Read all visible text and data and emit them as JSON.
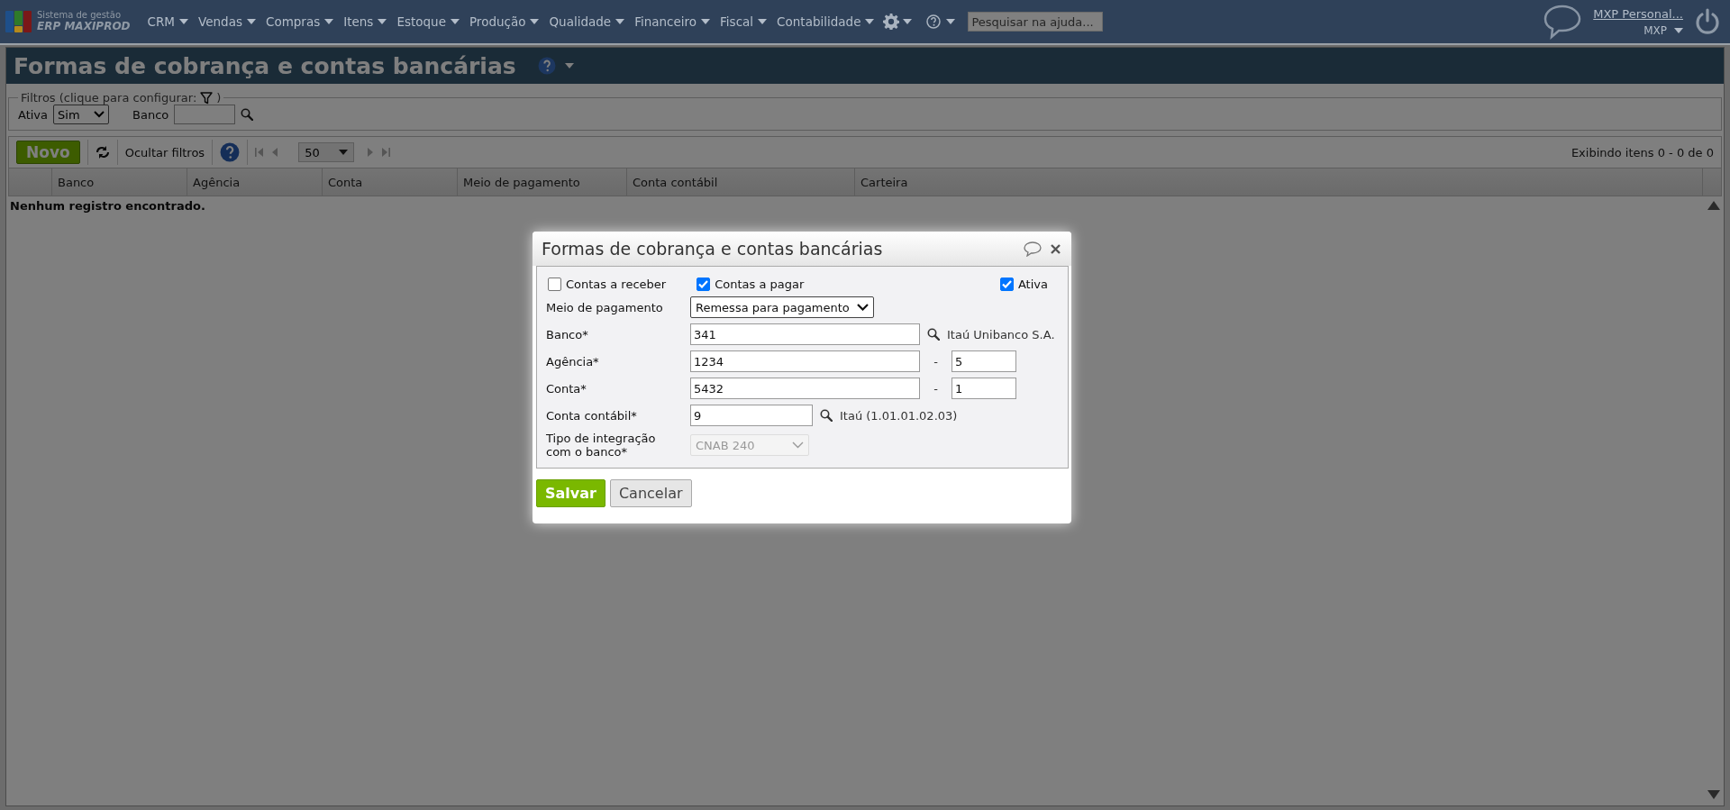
{
  "logo": {
    "line1": "Sistema de gestão",
    "line2": "ERP MAXIPROD"
  },
  "nav": [
    {
      "label": "CRM"
    },
    {
      "label": "Vendas"
    },
    {
      "label": "Compras"
    },
    {
      "label": "Itens"
    },
    {
      "label": "Estoque"
    },
    {
      "label": "Produção"
    },
    {
      "label": "Qualidade"
    },
    {
      "label": "Financeiro"
    },
    {
      "label": "Fiscal"
    },
    {
      "label": "Contabilidade"
    }
  ],
  "help_search": {
    "placeholder": "Pesquisar na ajuda..."
  },
  "user": {
    "name": "MXP Personal...",
    "company": "MXP"
  },
  "page": {
    "title": "Formas de cobrança e contas bancárias"
  },
  "filters": {
    "legend": "Filtros (clique para configurar:",
    "legend_end": ")",
    "fields": [
      {
        "kind": "select",
        "label": "Ativa",
        "value": "Sim"
      },
      {
        "kind": "lookup",
        "label": "Banco"
      }
    ]
  },
  "toolbar": {
    "new_button": "Novo",
    "hide_filters": "Ocultar filtros",
    "page_size": "50",
    "summary": "Exibindo itens 0 - 0 de 0"
  },
  "table": {
    "columns": [
      "Banco",
      "Agência",
      "Conta",
      "Meio de pagamento",
      "Conta contábil",
      "Carteira"
    ],
    "empty_message": "Nenhum registro encontrado."
  },
  "dialog": {
    "title": "Formas de cobrança e contas bancárias",
    "checkboxes": [
      {
        "label": "Contas a receber",
        "checked": false
      },
      {
        "label": "Contas a pagar",
        "checked": true
      },
      {
        "label": "Ativa",
        "checked": true
      }
    ],
    "fields": [
      {
        "kind": "select",
        "label": "Meio de pagamento",
        "value": "Remessa para pagamento",
        "disabled": false
      },
      {
        "kind": "lookup",
        "label": "Banco*",
        "value": "341",
        "description": "Itaú Unibanco S.A."
      },
      {
        "kind": "split",
        "label": "Agência*",
        "value": "1234",
        "separator": "-",
        "digit": "5"
      },
      {
        "kind": "split",
        "label": "Conta*",
        "value": "5432",
        "separator": "-",
        "digit": "1"
      },
      {
        "kind": "lookup_short",
        "label": "Conta contábil*",
        "value": "9",
        "description": "Itaú (1.01.01.02.03)"
      },
      {
        "kind": "select",
        "label": "Tipo de integração com o banco*",
        "value": "CNAB 240",
        "disabled": true
      }
    ],
    "buttons": [
      {
        "kind": "primary",
        "label": "Salvar"
      },
      {
        "kind": "secondary",
        "label": "Cancelar"
      }
    ]
  }
}
